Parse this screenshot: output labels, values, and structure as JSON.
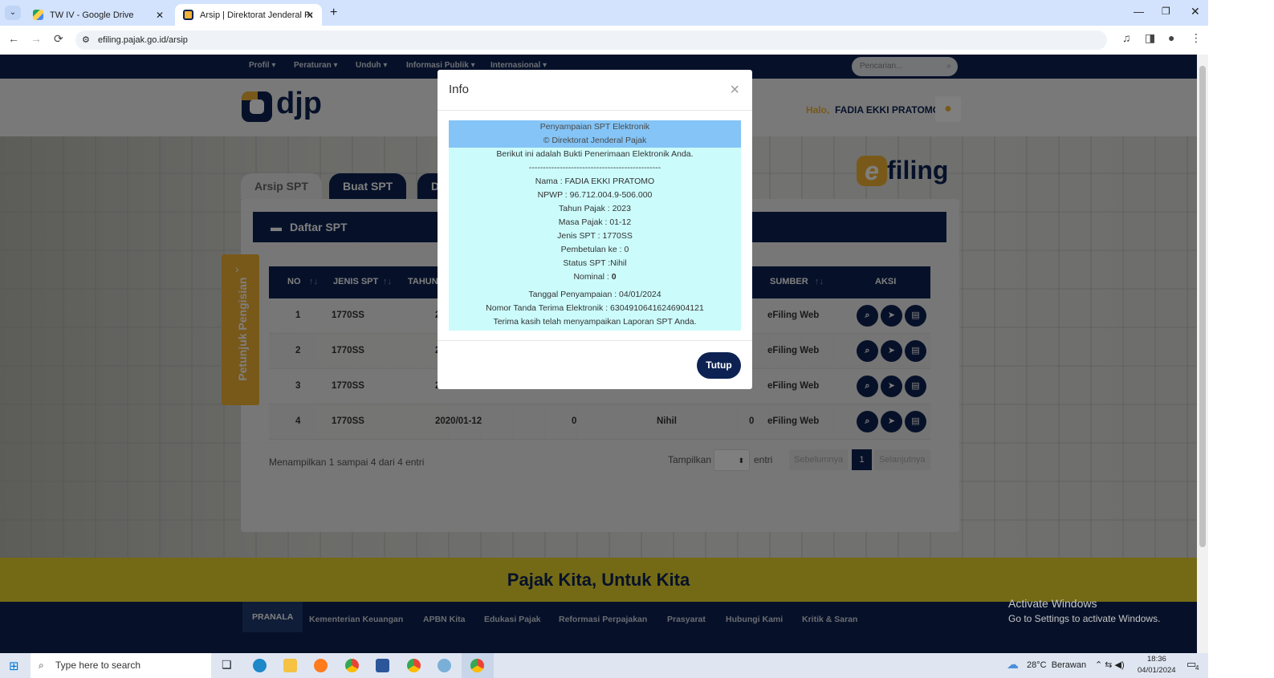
{
  "browser": {
    "tabs": [
      {
        "title": "TW IV - Google Drive",
        "active": false
      },
      {
        "title": "Arsip | Direktorat Jenderal Pajak",
        "active": true
      }
    ],
    "url": "efiling.pajak.go.id/arsip"
  },
  "site": {
    "nav": [
      "Profil ▾",
      "Peraturan ▾",
      "Unduh ▾",
      "Informasi Publik ▾",
      "Internasional ▾"
    ],
    "search_placeholder": "Pencarian...",
    "logo_text": "djp",
    "greeting": "Halo,",
    "user_name": "FADIA EKKI PRATOMO",
    "efiling_logo": "filing",
    "tabs": [
      "Arsip SPT",
      "Buat SPT",
      "D"
    ],
    "section_title": "Daftar SPT",
    "side_tab_label": "Petunjuk Pengisian",
    "table": {
      "headers": [
        "NO",
        "JENIS SPT",
        "TAHUN",
        "SUMBER",
        "AKSI"
      ],
      "rows": [
        {
          "no": "1",
          "jenis": "1770SS",
          "tahun": "2",
          "pembetulan": "",
          "status": "",
          "nominal": "",
          "sumber": "eFiling Web"
        },
        {
          "no": "2",
          "jenis": "1770SS",
          "tahun": "2",
          "pembetulan": "",
          "status": "",
          "nominal": "",
          "sumber": "eFiling Web"
        },
        {
          "no": "3",
          "jenis": "1770SS",
          "tahun": "2",
          "pembetulan": "",
          "status": "",
          "nominal": "",
          "sumber": "eFiling Web"
        },
        {
          "no": "4",
          "jenis": "1770SS",
          "tahun": "2020/01-12",
          "pembetulan": "0",
          "status": "Nihil",
          "nominal": "0",
          "sumber": "eFiling Web"
        }
      ]
    },
    "pagination": {
      "info": "Menampilkan 1 sampai 4 dari 4 entri",
      "show_label": "Tampilkan",
      "entries_label": "entri",
      "prev": "Sebelumnya",
      "current": "1",
      "next": "Selanjutnya"
    },
    "tagline": "Pajak Kita, Untuk Kita",
    "footer_nav": [
      "PRANALA",
      "Kementerian Keuangan",
      "APBN Kita",
      "Edukasi Pajak",
      "Reformasi Perpajakan",
      "Prasyarat",
      "Hubungi Kami",
      "Kritik & Saran"
    ]
  },
  "modal": {
    "title": "Info",
    "close": "×",
    "receipt": {
      "header1": "Penyampaian SPT Elektronik",
      "header2": "© Direktorat Jenderal Pajak",
      "intro": "Berikut ini adalah Bukti Penerimaan Elektronik Anda.",
      "separator": "-----------------------------------------------",
      "nama": "Nama : FADIA EKKI PRATOMO",
      "npwp": "NPWP : 96.712.004.9-506.000",
      "tahun": "Tahun Pajak : 2023",
      "masa": "Masa Pajak : 01-12",
      "jenis": "Jenis SPT : 1770SS",
      "pembetulan": "Pembetulan ke : 0",
      "status": "Status SPT :Nihil",
      "nominal_label": "Nominal : ",
      "nominal_value": "0",
      "tanggal": "Tanggal Penyampaian : 04/01/2024",
      "nomor": "Nomor Tanda Terima Elektronik : 630491064162469041­21",
      "thanks": "Terima kasih telah menyampaikan Laporan SPT Anda."
    },
    "button": "Tutup"
  },
  "windows": {
    "watermark_title": "Activate Windows",
    "watermark_sub": "Go to Settings to activate Windows.",
    "search": "Type here to search",
    "weather": "28°C  Berawan",
    "time": "18:36",
    "date": "04/01/2024",
    "notifications": "4"
  }
}
